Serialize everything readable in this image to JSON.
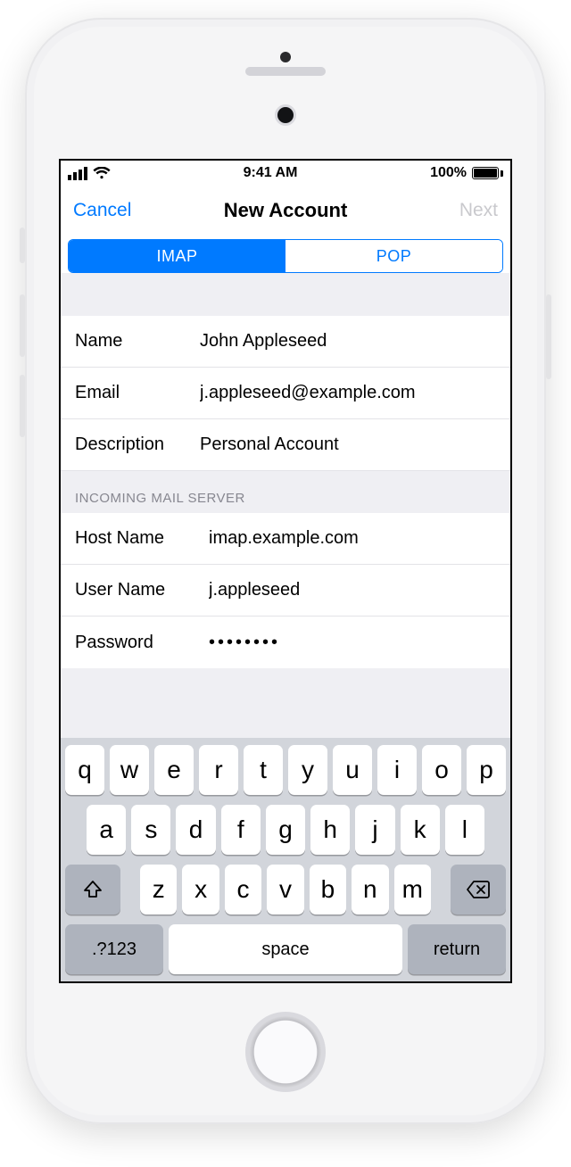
{
  "status": {
    "time": "9:41 AM",
    "battery": "100%"
  },
  "nav": {
    "cancel": "Cancel",
    "title": "New Account",
    "next": "Next"
  },
  "seg": {
    "imap": "IMAP",
    "pop": "POP"
  },
  "account": {
    "name_label": "Name",
    "name_value": "John Appleseed",
    "email_label": "Email",
    "email_value": "j.appleseed@example.com",
    "desc_label": "Description",
    "desc_value": "Personal Account"
  },
  "incoming": {
    "header": "INCOMING MAIL SERVER",
    "host_label": "Host Name",
    "host_value": "imap.example.com",
    "user_label": "User Name",
    "user_value": "j.appleseed",
    "pass_label": "Password",
    "pass_value": "••••••••"
  },
  "kbd": {
    "r1": [
      "q",
      "w",
      "e",
      "r",
      "t",
      "y",
      "u",
      "i",
      "o",
      "p"
    ],
    "r2": [
      "a",
      "s",
      "d",
      "f",
      "g",
      "h",
      "j",
      "k",
      "l"
    ],
    "r3": [
      "z",
      "x",
      "c",
      "v",
      "b",
      "n",
      "m"
    ],
    "numsym": ".?123",
    "space": "space",
    "return": "return"
  }
}
